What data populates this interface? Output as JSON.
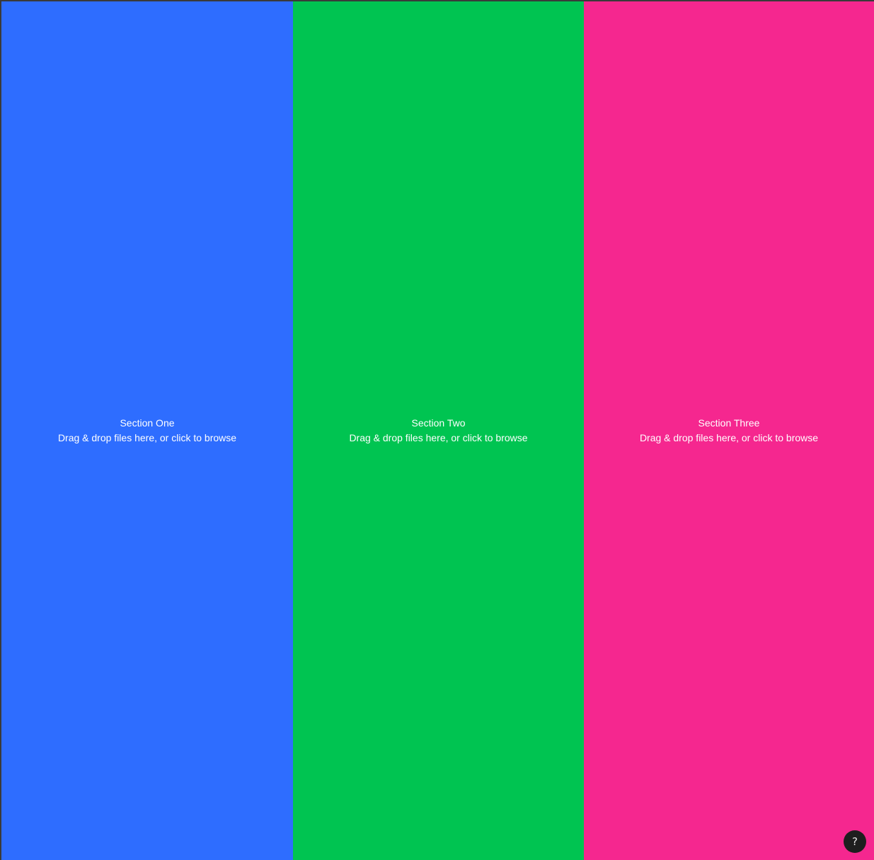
{
  "sections": [
    {
      "title": "Section One",
      "hint": "Drag & drop files here, or click to browse",
      "color": "#2e6dff"
    },
    {
      "title": "Section Two",
      "hint": "Drag & drop files here, or click to browse",
      "color": "#00c451"
    },
    {
      "title": "Section Three",
      "hint": "Drag & drop files here, or click to browse",
      "color": "#f5278f"
    }
  ],
  "help": {
    "label": "?",
    "icon": "question-mark-icon",
    "background": "#1e1e1e"
  }
}
